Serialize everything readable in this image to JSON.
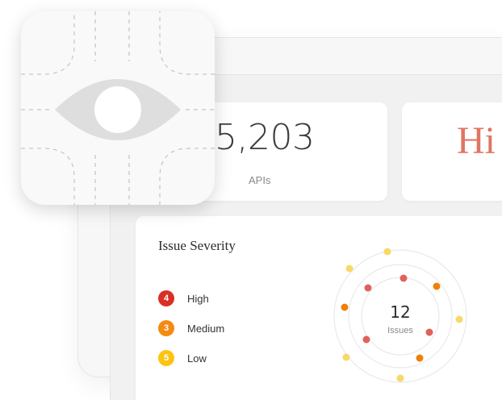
{
  "stats": {
    "apis": {
      "value": "5,203",
      "label": "APIs"
    },
    "risk": {
      "value": "Hi"
    }
  },
  "severity": {
    "title": "Issue Severity",
    "legend": [
      {
        "count": "4",
        "label": "High",
        "color": "#d93025"
      },
      {
        "count": "3",
        "label": "Medium",
        "color": "#f58a12"
      },
      {
        "count": "5",
        "label": "Low",
        "color": "#fbc414"
      }
    ],
    "total": {
      "value": "12",
      "label": "Issues"
    }
  },
  "colors": {
    "accent_red": "#e07562",
    "dot_red": "#e0625a",
    "dot_orange": "#f07f0a",
    "dot_yellow": "#f9d86a"
  },
  "icons": {
    "overlay": "eye-icon"
  }
}
